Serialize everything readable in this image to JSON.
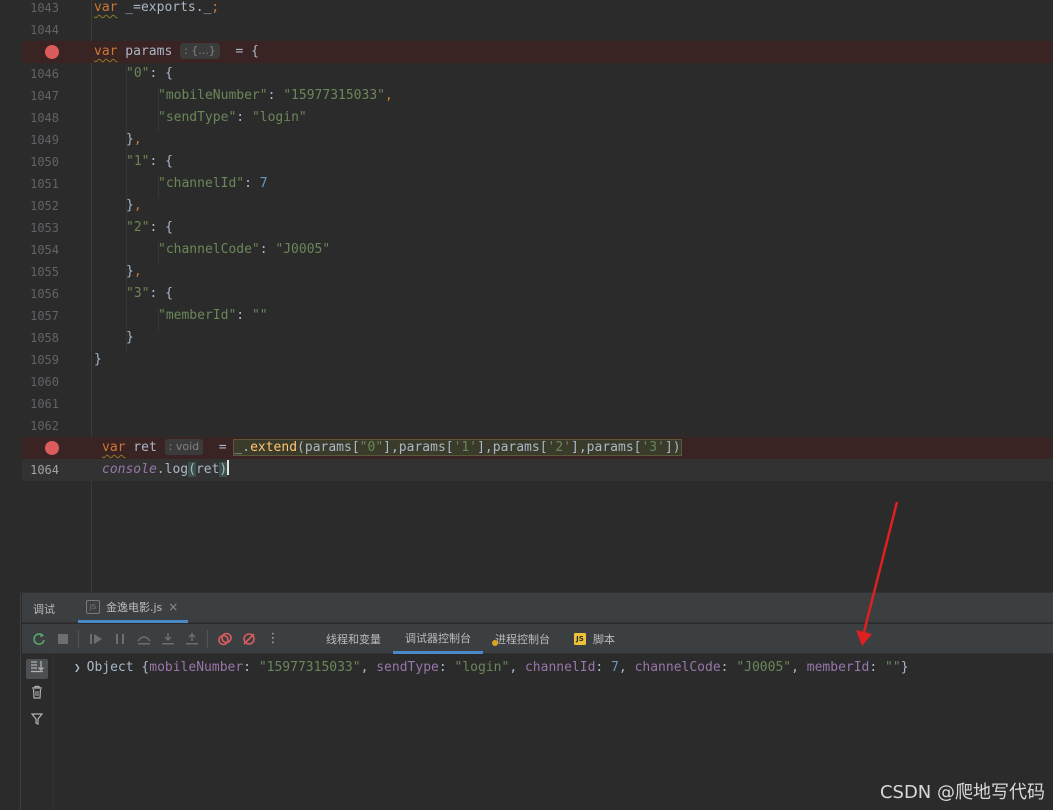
{
  "editor": {
    "lines": [
      {
        "num": "1043"
      },
      {
        "num": "1044"
      },
      {
        "num": "1045"
      },
      {
        "num": "1046"
      },
      {
        "num": "1047"
      },
      {
        "num": "1048"
      },
      {
        "num": "1049"
      },
      {
        "num": "1050"
      },
      {
        "num": "1051"
      },
      {
        "num": "1052"
      },
      {
        "num": "1053"
      },
      {
        "num": "1054"
      },
      {
        "num": "1055"
      },
      {
        "num": "1056"
      },
      {
        "num": "1057"
      },
      {
        "num": "1058"
      },
      {
        "num": "1059"
      },
      {
        "num": "1060"
      },
      {
        "num": "1061"
      },
      {
        "num": "1062"
      },
      {
        "num": "1063"
      },
      {
        "num": "1064"
      }
    ],
    "code": {
      "l1043": {
        "kw": "var",
        "rest": " _=exports._",
        "semi": ";"
      },
      "l1045": {
        "kw": "var",
        "name": " params ",
        "hint": ": {...}",
        "assign": "  = {"
      },
      "l1046": {
        "key": "\"0\"",
        "rest": ": {"
      },
      "l1047": {
        "key": "\"mobileNumber\"",
        "colon": ": ",
        "val": "\"15977315033\"",
        "comma": ","
      },
      "l1048": {
        "key": "\"sendType\"",
        "colon": ": ",
        "val": "\"login\""
      },
      "l1049": {
        "brace": "}",
        "comma": ","
      },
      "l1050": {
        "key": "\"1\"",
        "rest": ": {"
      },
      "l1051": {
        "key": "\"channelId\"",
        "colon": ": ",
        "val": "7"
      },
      "l1052": {
        "brace": "}",
        "comma": ","
      },
      "l1053": {
        "key": "\"2\"",
        "rest": ": {"
      },
      "l1054": {
        "key": "\"channelCode\"",
        "colon": ": ",
        "val": "\"J0005\""
      },
      "l1055": {
        "brace": "}",
        "comma": ","
      },
      "l1056": {
        "key": "\"3\"",
        "rest": ": {"
      },
      "l1057": {
        "key": "\"memberId\"",
        "colon": ": ",
        "val": "\"\""
      },
      "l1058": {
        "brace": "}"
      },
      "l1059": {
        "brace": "}"
      },
      "l1063": {
        "kw": "var",
        "name": " ret ",
        "hint": ": void",
        "assign": "  = ",
        "obj": "_",
        "dot": ".",
        "fn": "extend",
        "open": "(params[",
        "a0": "\"0\"",
        "c1": "],params[",
        "a1": "'1'",
        "c2": "],params[",
        "a2": "'2'",
        "c3": "],params[",
        "a3": "'3'",
        "close": "])"
      },
      "l1064": {
        "console": "console",
        "dot": ".",
        "fn": "log",
        "open": "(",
        "arg": "ret",
        "close": ")"
      }
    }
  },
  "debug": {
    "title": "调试",
    "run_tab": {
      "icon": "js-file-icon",
      "label": "金逸电影.js",
      "close": "×"
    },
    "toolbar": {
      "buttons": [
        "rerun-icon",
        "stop-icon",
        "resume-icon",
        "pause-icon",
        "step-over-icon",
        "step-into-icon",
        "step-out-icon",
        "breakpoints-icon",
        "mute-breakpoints-icon",
        "more-icon"
      ],
      "more": "⋮"
    },
    "tabs": [
      {
        "label": "线程和变量"
      },
      {
        "label": "调试器控制台",
        "active": true
      },
      {
        "label": "进程控制台"
      },
      {
        "label": "脚本",
        "badge": "JS"
      }
    ],
    "console": {
      "prefix": "Object ",
      "open": "{",
      "k1": "mobileNumber",
      "v1": "\"15977315033\"",
      "k2": "sendType",
      "v2": "\"login\"",
      "k3": "channelId",
      "v3": "7",
      "k4": "channelCode",
      "v4": "\"J0005\"",
      "k5": "memberId",
      "v5": "\"\"",
      "sep": ": ",
      "comma": ", ",
      "close": "}"
    }
  },
  "watermark": "CSDN @爬地写代码",
  "colors": {
    "breakpoint": "#db5c5c",
    "accent": "#4a88c7",
    "arrow": "#e02020"
  }
}
